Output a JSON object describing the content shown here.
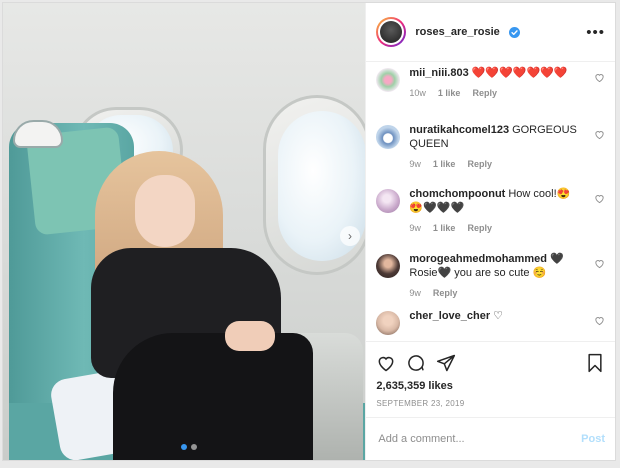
{
  "post": {
    "username": "roses_are_rosie",
    "more_label": "•••"
  },
  "carousel": {
    "next_glyph": "›",
    "total_slides": 2,
    "active_slide": 1
  },
  "comments": [
    {
      "user": "mii_niii.803",
      "text": "❤️❤️❤️❤️❤️❤️❤️",
      "age": "10w",
      "likes": "1 like",
      "reply": "Reply",
      "avatar_color": "#f2e9f2"
    },
    {
      "user": "nuratikahcomel123",
      "text": "GORGEOUS QUEEN",
      "age": "9w",
      "likes": "1 like",
      "reply": "Reply",
      "avatar_color": "#bfd4ea"
    },
    {
      "user": "chomchompoonut",
      "text": "How cool!😍😍🖤🖤🖤",
      "age": "9w",
      "likes": "1 like",
      "reply": "Reply",
      "avatar_color": "#c7a6c9"
    },
    {
      "user": "morogeahmedmohammed",
      "text": "🖤 Rosie🖤 you are so cute ☺️",
      "age": "9w",
      "likes": "",
      "reply": "Reply",
      "avatar_color": "#4d3a36"
    },
    {
      "user": "cher_love_cher",
      "text": "♡",
      "age": "",
      "likes": "",
      "reply": "",
      "avatar_color": "#d9b9a6"
    }
  ],
  "stats": {
    "likes": "2,635,359 likes",
    "date": "SEPTEMBER 23, 2019"
  },
  "comment_form": {
    "placeholder": "Add a comment...",
    "post_label": "Post"
  },
  "colors": {
    "accent": "#3897f0",
    "verified": "#3897f0",
    "post_disabled": "#b2dffc",
    "muted": "#8e8e8e"
  },
  "icons": {
    "like": "heart-icon",
    "comment": "comment-icon",
    "share": "paper-plane-icon",
    "save": "bookmark-icon",
    "verified": "verified-badge-icon",
    "more": "more-options-icon"
  }
}
